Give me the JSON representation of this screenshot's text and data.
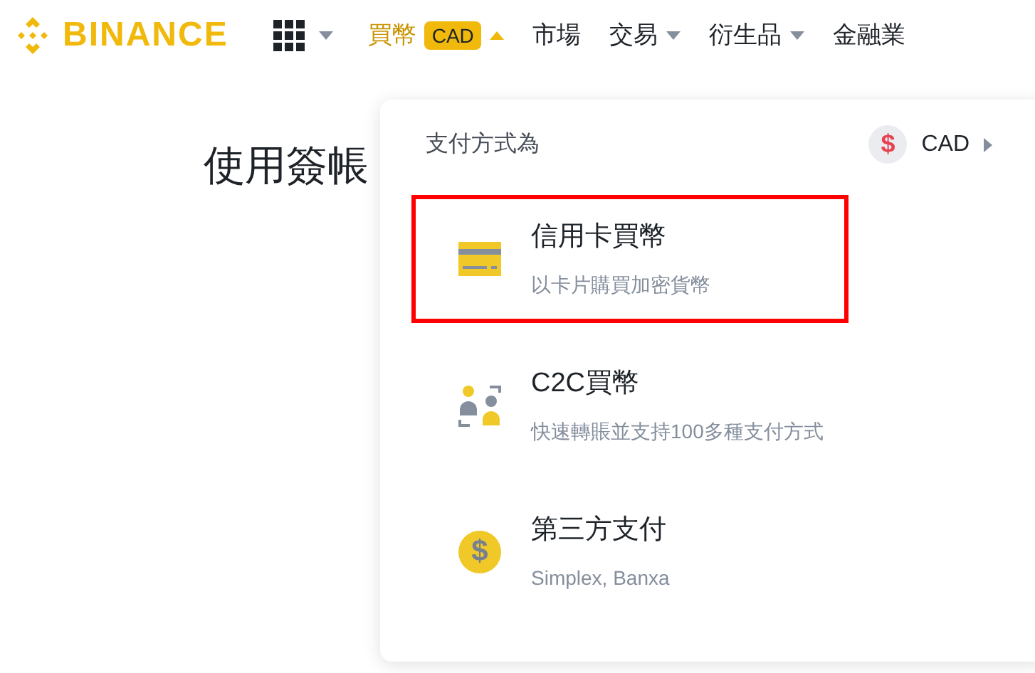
{
  "logo": {
    "text": "BINANCE"
  },
  "nav": [
    {
      "kind": "apps",
      "caret": true,
      "selected": false,
      "expanded": false
    },
    {
      "kind": "link",
      "label": "買幣",
      "badge": "CAD",
      "caret": true,
      "selected": true,
      "expanded": true
    },
    {
      "kind": "link",
      "label": "市場",
      "caret": false,
      "selected": false
    },
    {
      "kind": "link",
      "label": "交易",
      "caret": true,
      "selected": false,
      "expanded": false
    },
    {
      "kind": "link",
      "label": "衍生品",
      "caret": true,
      "selected": false,
      "expanded": false
    },
    {
      "kind": "link",
      "label": "金融業",
      "caret": false,
      "selected": false
    }
  ],
  "page": {
    "heading": "使用簽帳"
  },
  "dropdown": {
    "label": "支付方式為",
    "currency": {
      "symbol": "$",
      "code": "CAD"
    },
    "items": [
      {
        "kind": "card",
        "title": "信用卡買幣",
        "subtitle": "以卡片購買加密貨幣",
        "highlighted": true
      },
      {
        "kind": "c2c",
        "title": "C2C買幣",
        "subtitle": "快速轉賬並支持100多種支付方式",
        "highlighted": false
      },
      {
        "kind": "coin",
        "icon_symbol": "$",
        "title": "第三方支付",
        "subtitle": "Simplex, Banxa",
        "highlighted": false
      }
    ]
  }
}
